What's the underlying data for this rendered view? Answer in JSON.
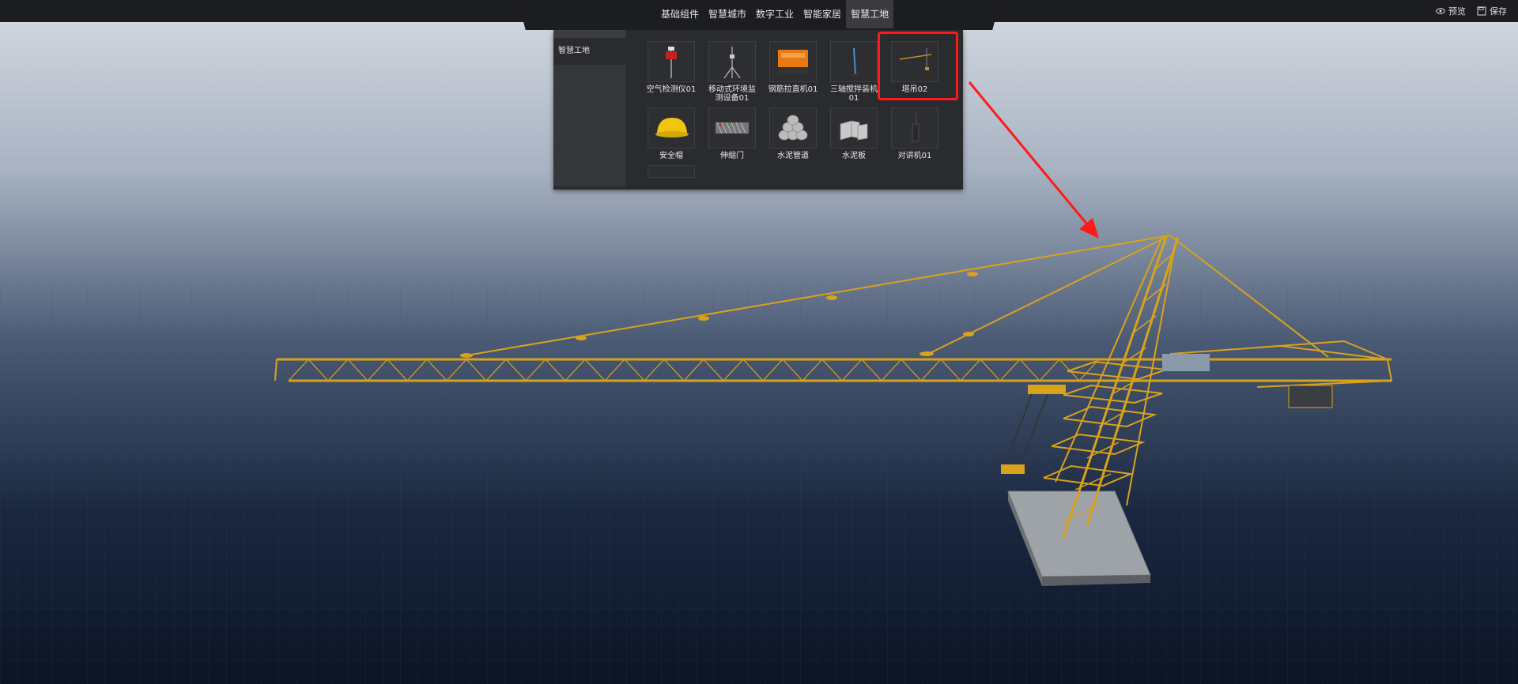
{
  "header": {
    "tabs": [
      {
        "label": "基础组件"
      },
      {
        "label": "智慧城市"
      },
      {
        "label": "数字工业"
      },
      {
        "label": "智能家居"
      },
      {
        "label": "智慧工地",
        "active": true
      }
    ],
    "actions": {
      "preview_label": "预览",
      "save_label": "保存"
    }
  },
  "panel": {
    "sidebar": {
      "items": [
        {
          "label": "智慧工地"
        }
      ]
    },
    "components": [
      {
        "label": "空气检测仪01",
        "icon": "air-monitor-icon"
      },
      {
        "label": "移动式环境监测设备01",
        "icon": "tripod-monitor-icon"
      },
      {
        "label": "钢筋拉直机01",
        "icon": "rebar-straightener-icon"
      },
      {
        "label": "三轴搅拌装机01",
        "icon": "three-axis-mixer-icon"
      },
      {
        "label": "塔吊02",
        "icon": "tower-crane-icon",
        "highlighted": true
      },
      {
        "label": "安全帽",
        "icon": "safety-helmet-icon"
      },
      {
        "label": "伸缩门",
        "icon": "retractable-gate-icon"
      },
      {
        "label": "水泥管道",
        "icon": "cement-pipe-icon"
      },
      {
        "label": "水泥板",
        "icon": "cement-board-icon"
      },
      {
        "label": "对讲机01",
        "icon": "walkie-talkie-icon"
      }
    ]
  },
  "colors": {
    "highlight": "#ff1a1a",
    "crane": "#d9a21b",
    "topbar": "#1c1d20",
    "active_tab": "#3a3b3f"
  }
}
